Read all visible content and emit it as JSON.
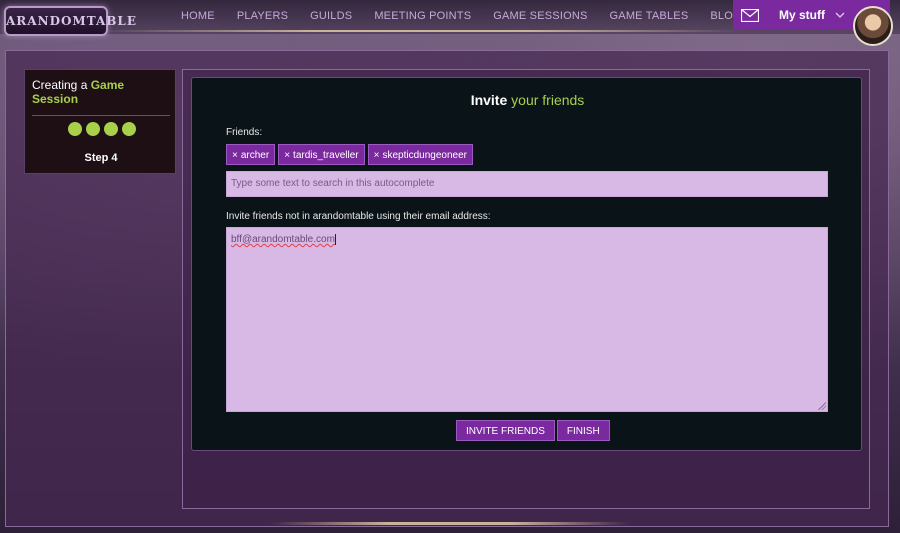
{
  "header": {
    "logo_text": "ARANDOMTABLE",
    "nav": [
      "HOME",
      "PLAYERS",
      "GUILDS",
      "MEETING POINTS",
      "GAME SESSIONS",
      "GAME TABLES",
      "BLOG"
    ],
    "mystuff_label": "My stuff"
  },
  "sidebar": {
    "title_prefix": "Creating a ",
    "title_highlight": "Game Session",
    "steps_completed": 4,
    "step_label": "Step 4"
  },
  "main": {
    "title_strong": "Invite",
    "title_rest": " your friends",
    "friends_label": "Friends:",
    "friends": [
      "archer",
      "tardis_traveller",
      "skepticdungeoneer"
    ],
    "search_placeholder": "Type some text to search in this autocomplete",
    "email_label": "Invite friends not in arandomtable using their email address:",
    "email_value": "bff@arandomtable.com",
    "invite_button": "INVITE FRIENDS",
    "finish_button": "FINISH"
  },
  "colors": {
    "accent_purple": "#7a2a9e",
    "accent_green": "#a8d04a",
    "input_bg": "#d8b8e4"
  }
}
